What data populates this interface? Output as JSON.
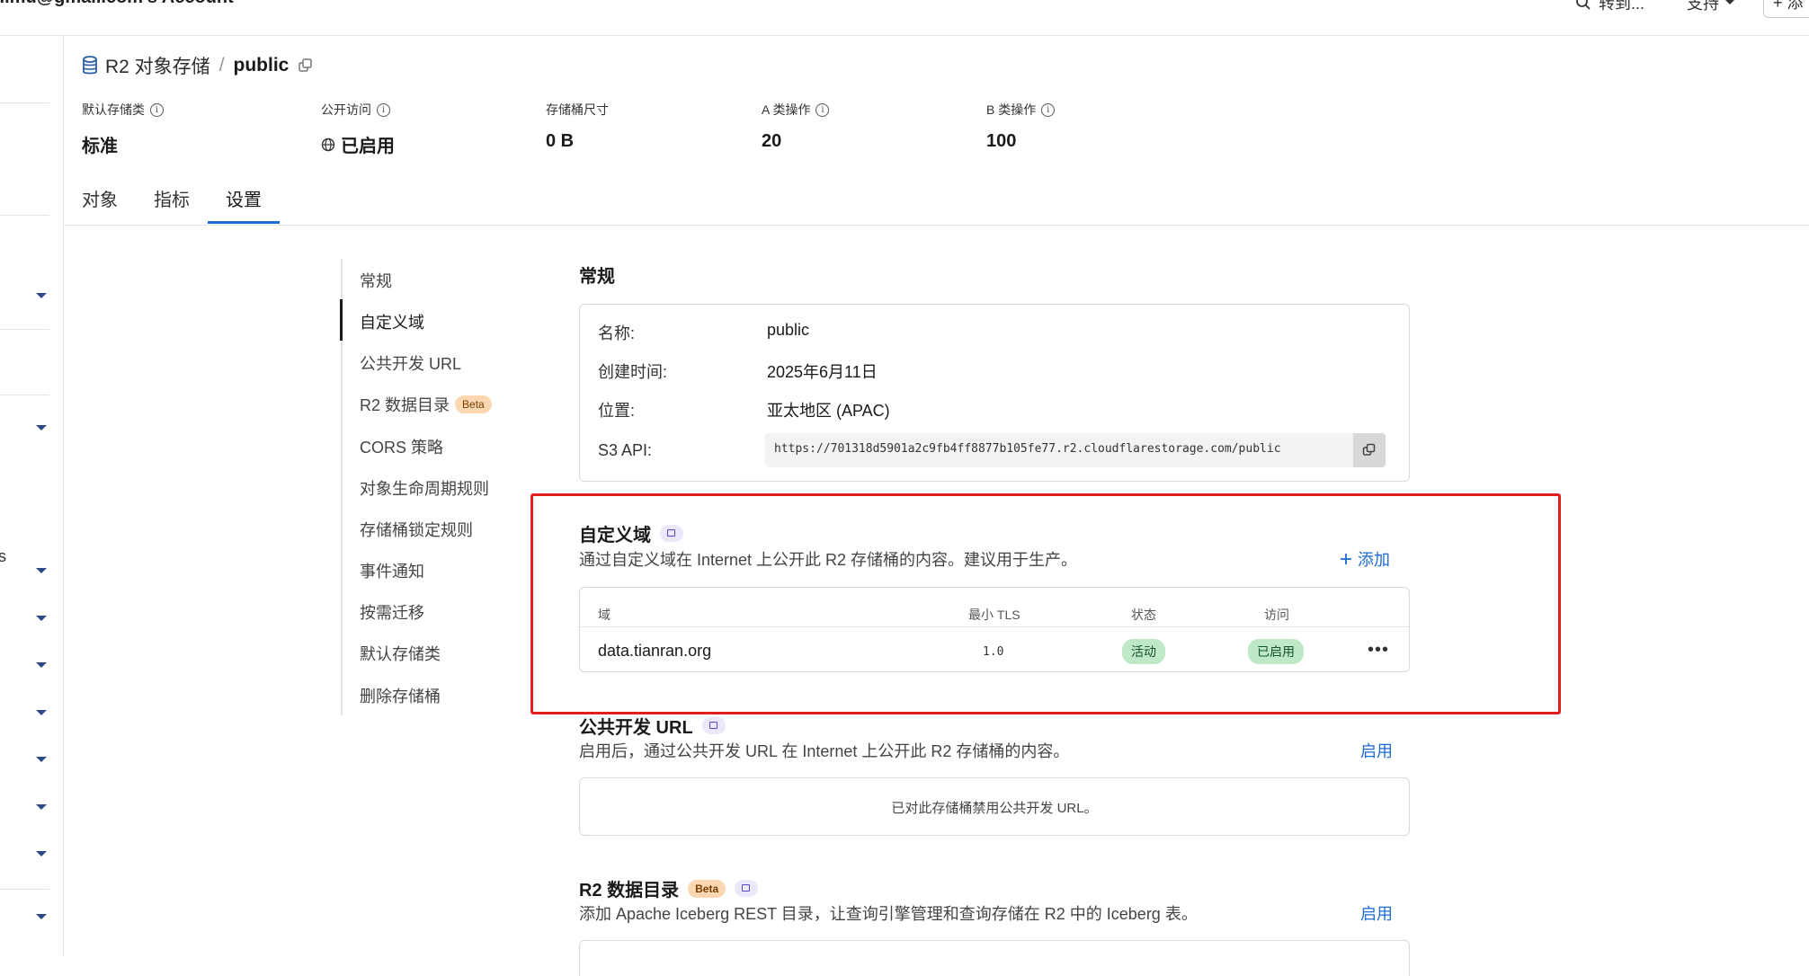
{
  "topbar": {
    "account_title": "...mu@gmail.com's Account",
    "goto_label": "转到...",
    "support_label": "支持",
    "add_label": "+ 添"
  },
  "sidebar": {
    "partial_label": "s"
  },
  "bucket": {
    "breadcrumb_root": "R2 对象存储",
    "separator": "/",
    "name": "public"
  },
  "stats": [
    {
      "label": "默认存储类",
      "value": "标准",
      "has_info": true
    },
    {
      "label": "公开访问",
      "value": "已启用",
      "has_info": true
    },
    {
      "label": "存储桶尺寸",
      "value": "0 B",
      "has_info": false
    },
    {
      "label": "A 类操作",
      "value": "20",
      "has_info": true
    },
    {
      "label": "B 类操作",
      "value": "100",
      "has_info": true
    }
  ],
  "tabs": [
    "对象",
    "指标",
    "设置"
  ],
  "active_tab": "设置",
  "subnav": {
    "items": [
      "常规",
      "自定义域",
      "公共开发 URL",
      "R2 数据目录",
      "CORS 策略",
      "对象生命周期规则",
      "存储桶锁定规则",
      "事件通知",
      "按需迁移",
      "默认存储类",
      "删除存储桶"
    ],
    "beta_label": "Beta",
    "active": "自定义域"
  },
  "general": {
    "title": "常规",
    "name_label": "名称:",
    "name_value": "public",
    "created_label": "创建时间:",
    "created_value": "2025年6月11日",
    "location_label": "位置:",
    "location_value": "亚太地区 (APAC)",
    "s3_label": "S3 API:",
    "s3_value": "https://701318d5901a2c9fb4ff8877b105fe77.r2.cloudflarestorage.com/public"
  },
  "custom_domains": {
    "title": "自定义域",
    "description": "通过自定义域在 Internet 上公开此 R2 存储桶的内容。建议用于生产。",
    "add_label": "添加",
    "columns": [
      "域",
      "最小 TLS",
      "状态",
      "访问"
    ],
    "rows": [
      {
        "domain": "data.tianran.org",
        "min_tls": "1.0",
        "status": "活动",
        "access": "已启用"
      }
    ]
  },
  "public_dev_url": {
    "title": "公共开发 URL",
    "description": "启用后，通过公共开发 URL 在 Internet 上公开此 R2 存储桶的内容。",
    "enable_label": "启用",
    "disabled_message": "已对此存储桶禁用公共开发 URL。"
  },
  "data_catalog": {
    "title": "R2 数据目录",
    "beta_label": "Beta",
    "description": "添加 Apache Iceberg REST 目录，让查询引擎管理和查询存储在 R2 中的 Iceberg 表。",
    "enable_label": "启用"
  },
  "colors": {
    "accent": "#1d6bd6",
    "highlight": "#e0201e",
    "success_bg": "#bfe8c7",
    "beta_bg": "#fbd8b2"
  }
}
